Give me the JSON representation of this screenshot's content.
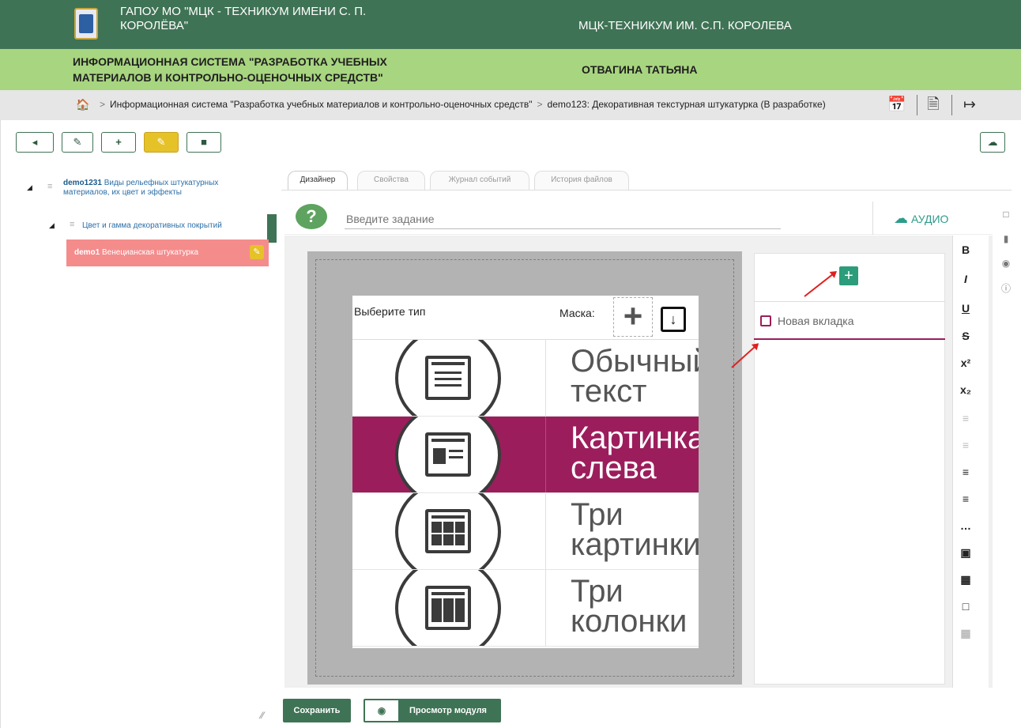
{
  "header": {
    "org_name": "ГАПОУ МО \"МЦК - ТЕХНИКУМ ИМЕНИ С. П. КОРОЛЁВА\"",
    "org_short": "МЦК-ТЕХНИКУМ ИМ. С.П. КОРОЛЕВА",
    "system_name": "ИНФОРМАЦИОННАЯ СИСТЕМА \"РАЗРАБОТКА УЧЕБНЫХ МАТЕРИАЛОВ И КОНТРОЛЬНО-ОЦЕНОЧНЫХ СРЕДСТВ\"",
    "user_name": "ОТВАГИНА ТАТЬЯНА"
  },
  "breadcrumb": {
    "item1": "Информационная система \"Разработка учебных материалов и контрольно-оценочных средств\"",
    "item2": "demo123: Декоративная текстурная штукатурка (В разработке)"
  },
  "tree": {
    "node1_code": "demo1231",
    "node1_title": "Виды рельефных штукатурных материалов, их цвет и эффекты",
    "node2_title": "Цвет и гамма декоративных покрытий",
    "node3_code": "demo1",
    "node3_title": "Венецианская штукатурка"
  },
  "tabs": [
    "Дизайнер",
    "Свойства",
    "Журнал событий",
    "История файлов"
  ],
  "task": {
    "placeholder": "Введите задание"
  },
  "audio_label": "АУДИО",
  "designer": {
    "select_type_label": "Выберите тип",
    "mask_label": "Маска:",
    "types": [
      {
        "label1": "Обычный",
        "label2": "текст",
        "selected": false
      },
      {
        "label1": "Картинка",
        "label2": "слева",
        "selected": true
      },
      {
        "label1": "Три",
        "label2": "картинки",
        "selected": false
      },
      {
        "label1": "Три",
        "label2": "колонки",
        "selected": false
      }
    ]
  },
  "tabs_panel": {
    "new_tab_label": "Новая вкладка"
  },
  "format_toolbar": [
    "B",
    "I",
    "U",
    "S",
    "x²",
    "x₂"
  ],
  "buttons": {
    "save": "Сохранить",
    "preview": "Просмотр модуля"
  },
  "colors": {
    "header_dark": "#3f7355",
    "header_light": "#a8d580",
    "accent": "#9c1d5c",
    "selected_tree": "#f48c8c"
  }
}
